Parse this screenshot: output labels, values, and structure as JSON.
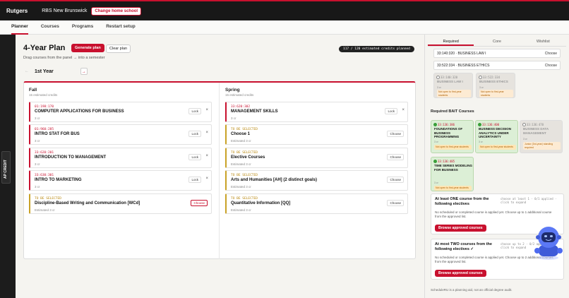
{
  "topbar": {
    "brand": "Rutgers",
    "campus": "RBS New Brunswick",
    "change_school": "Change home school"
  },
  "nav": {
    "items": [
      {
        "label": "Planner",
        "active": true
      },
      {
        "label": "Courses",
        "active": false
      },
      {
        "label": "Programs",
        "active": false
      },
      {
        "label": "Restart setup",
        "active": false
      }
    ]
  },
  "ap_credit": "AP CREDIT",
  "plan": {
    "title": "4-Year Plan",
    "generate_label": "Generate plan",
    "clear_label": "Clear plan",
    "hint": "Drag courses from the panel → into a semester",
    "credits_pill": "117 / 120 estimated credits planned",
    "prev_arrow": "←",
    "next_arrow": "→",
    "year": "1st Year",
    "fall": {
      "title": "Fall",
      "credits": "15 estimated credits",
      "courses": [
        {
          "code": "01:198:170",
          "title": "COMPUTER APPLICATIONS FOR BUSINESS",
          "sub": "3 cr",
          "lock": "Lock",
          "remove": "×"
        },
        {
          "code": "01:960:285",
          "title": "INTRO STAT FOR BUS",
          "sub": "3 cr",
          "lock": "Lock",
          "remove": "×"
        },
        {
          "code": "33:620:201",
          "title": "INTRODUCTION TO MANAGEMENT",
          "sub": "3 cr",
          "lock": "Lock",
          "remove": "×"
        },
        {
          "code": "33:630:301",
          "title": "INTRO TO MARKETING",
          "sub": "3 cr",
          "lock": "Lock",
          "remove": "×"
        },
        {
          "code": "TO BE SELECTED",
          "title": "Discipline-Based Writing and Communication [WCd]",
          "sub": "Estimated 3 cr",
          "choose": "Choose"
        }
      ]
    },
    "spring": {
      "title": "Spring",
      "credits": "15 estimated credits",
      "courses": [
        {
          "code": "33:620:302",
          "title": "MANAGEMENT SKILLS",
          "sub": "3 cr",
          "lock": "Lock",
          "remove": "×"
        },
        {
          "code": "TO BE SELECTED",
          "title": "Choose 1",
          "sub": "Estimated 3 cr",
          "choose": "Choose"
        },
        {
          "code": "TO BE SELECTED",
          "title": "Elective Courses",
          "sub": "Estimated 3 cr",
          "choose": "Choose"
        },
        {
          "code": "TO BE SELECTED",
          "title": "Arts and Humanities [AH] (2 distinct goals)",
          "sub": "Estimated 3 cr",
          "choose": "Choose"
        },
        {
          "code": "TO BE SELECTED",
          "title": "Quantitative Information [QQ]",
          "sub": "Estimated 3 cr",
          "choose": "Choose"
        }
      ]
    }
  },
  "panel": {
    "tabs": [
      {
        "label": "Required",
        "active": true
      },
      {
        "label": "Core",
        "active": false
      },
      {
        "label": "Wishlist",
        "active": false
      }
    ],
    "required_rows": [
      {
        "code": "33:140:320 · BUSINESS LAW I",
        "action": "Choose"
      },
      {
        "code": "33:522:334 · BUSINESS ETHICS",
        "action": "Choose"
      }
    ],
    "law_minis": [
      {
        "code": "33:140:320",
        "title": "BUSINESS LAW I",
        "cr": "3 cr",
        "warn": "Not open to first-year students"
      },
      {
        "code": "33:522:334",
        "title": "BUSINESS ETHICS",
        "cr": "3 cr",
        "warn": "Not open to first-year students"
      }
    ],
    "bait_heading": "Required BAIT Courses",
    "bait_minis": [
      {
        "code": "33:136:386",
        "title": "FOUNDATIONS OF BUSINESS PROGRAMMING",
        "cr": "3 cr",
        "warn": "Not open to first-year students",
        "status": "green"
      },
      {
        "code": "33:136:400",
        "title": "BUSINESS DECISION ANALYTICS UNDER UNCERTAINTY",
        "cr": "3 cr",
        "warn": "Not open to first-year students",
        "status": "green"
      },
      {
        "code": "33:136:470",
        "title": "BUSINESS DATA MANAGEMENT",
        "cr": "3 cr",
        "warn": "Junior (3rd-year) standing required",
        "status": "grey"
      },
      {
        "code": "33:136:485",
        "title": "TIME SERIES MODELING FOR BUSINESS",
        "cr": "3 cr",
        "warn": "Not open to first-year students",
        "status": "green"
      }
    ],
    "electives": [
      {
        "title": "At least ONE course from the following electives",
        "hint": "choose at least 1 · 0/1 applied · click to expand",
        "note": "No scheduled or completed course is applied yet. Choose up to 1 additional course from the approved list.",
        "button": "Browse approved courses"
      },
      {
        "title": "At most TWO courses from the following electives ✓",
        "hint": "choose up to 2 · 0/2 applied · click to expand",
        "note": "No scheduled or completed course is applied yet. Choose up to 2 additional courses from the approved list.",
        "button": "Browse approved courses"
      }
    ],
    "footer": "ScheduleRU is a planning aid, not an official degree audit."
  }
}
